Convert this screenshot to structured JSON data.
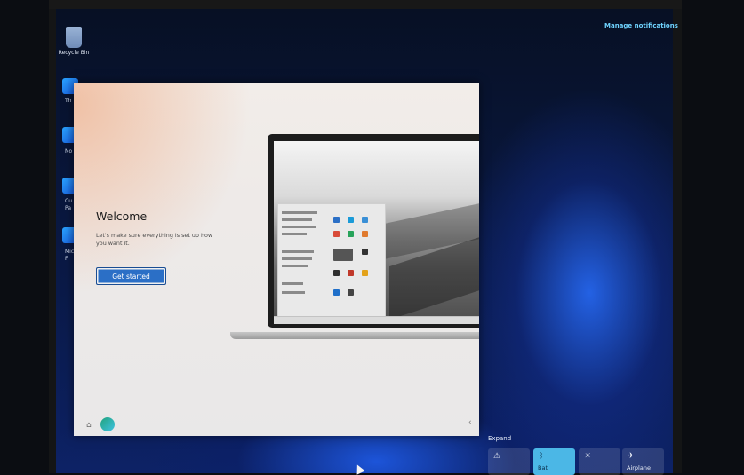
{
  "desktop": {
    "recycle_bin_label": "Recycle Bin",
    "side_labels": [
      "Th",
      "No",
      "Cu\nPa",
      "Mic\nF"
    ]
  },
  "notifications": {
    "manage_label": "Manage notifications"
  },
  "oobe": {
    "title": "Welcome",
    "subtitle": "Let's make sure everything is set up how you want it.",
    "primary_button": "Get started",
    "footer_home_icon": "home-icon",
    "footer_back_icon": "chevron-left-icon"
  },
  "quick_settings": {
    "expand_label": "Expand",
    "tiles": [
      {
        "label": "",
        "icon": "accessibility-icon"
      },
      {
        "label": "Bat",
        "icon": "bluetooth-icon",
        "active": true
      },
      {
        "label": "",
        "icon": "brightness-icon"
      },
      {
        "label": "Airplane",
        "icon": "airplane-icon"
      }
    ]
  },
  "colors": {
    "accent": "#2b6fc6",
    "active_tile": "#4bb7e6",
    "notif_link": "#6fd3ff"
  }
}
